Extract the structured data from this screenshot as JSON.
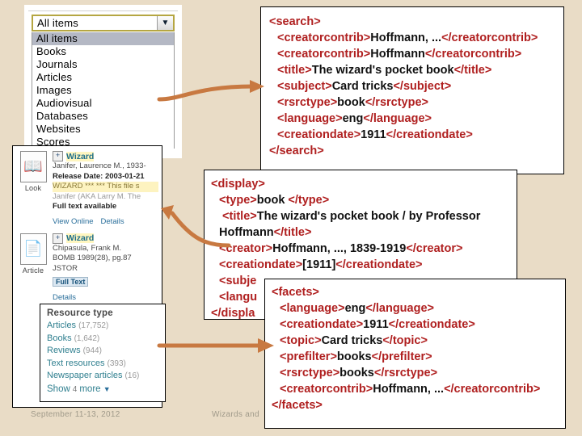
{
  "background_color": "#e9dcc6",
  "accent_arrow_color": "#c87941",
  "xml_tag_color": "#b02020",
  "dropdown": {
    "selected_value": "All items",
    "arrow_icon": "chevron-down-icon",
    "options": [
      "All items",
      "Books",
      "Journals",
      "Articles",
      "Images",
      "Audiovisual",
      "Databases",
      "Websites",
      "Scores"
    ]
  },
  "results": {
    "items": [
      {
        "icon_label": "Look",
        "icon_glyph": "book-icon",
        "expand": "+",
        "title": "Wizard",
        "lines": [
          "Janifer, Laurence M., 1933-",
          "Release Date: 2003-01-21",
          "WIZARD *** *** This file s",
          "Janifer (AKA Larry M.  The",
          "Full text available"
        ],
        "links": [
          "View Online",
          "Details"
        ]
      },
      {
        "icon_label": "Article",
        "icon_glyph": "article-icon",
        "expand": "+",
        "title": "Wizard",
        "lines": [
          "Chipasula, Frank M.",
          "BOMB  1989(28), pg.87",
          "JSTOR"
        ],
        "badge": "Full Text",
        "links": [
          "Details"
        ]
      }
    ]
  },
  "facet_panel": {
    "header": "Resource type",
    "rows": [
      {
        "label": "Articles",
        "count": "(17,752)"
      },
      {
        "label": "Books",
        "count": "(1,642)"
      },
      {
        "label": "Reviews",
        "count": "(944)"
      },
      {
        "label": "Text resources",
        "count": "(393)"
      },
      {
        "label": "Newspaper articles",
        "count": "(16)"
      }
    ],
    "more_label": "Show",
    "more_count": "4",
    "more_suffix": "more",
    "more_caret": "chevron-down-icon"
  },
  "search_xml": {
    "open": "<search>",
    "close": "</search>",
    "lines": [
      {
        "tag": "creatorcontrib",
        "value": "Hoffmann, ..."
      },
      {
        "tag": "creatorcontrib",
        "value": "Hoffmann"
      },
      {
        "tag": "title",
        "value": "The wizard's pocket book"
      },
      {
        "tag": "subject",
        "value": "Card tricks"
      },
      {
        "tag": "rsrctype",
        "value": "book"
      },
      {
        "tag": "language",
        "value": "eng"
      },
      {
        "tag": "creationdate",
        "value": "1911"
      }
    ]
  },
  "display_xml": {
    "open": "<display>",
    "close": "</display>",
    "lines": [
      {
        "tag": "type",
        "value": "book "
      },
      {
        "tag": "title",
        "value": "The wizard's pocket book / by Professor Hoffmann"
      },
      {
        "tag": "creator",
        "value": "Hoffmann, ..., 1839-1919"
      },
      {
        "tag": "creationdate",
        "value": "[1911]"
      },
      {
        "tag": "subject",
        "value": ""
      },
      {
        "tag": "language",
        "value": ""
      }
    ]
  },
  "facets_xml": {
    "open": "<facets>",
    "close": "</facets>",
    "lines": [
      {
        "tag": "language",
        "value": "eng"
      },
      {
        "tag": "creationdate",
        "value": "1911"
      },
      {
        "tag": "topic",
        "value": "Card tricks"
      },
      {
        "tag": "prefilter",
        "value": "books"
      },
      {
        "tag": "rsrctype",
        "value": "books"
      },
      {
        "tag": "creatorcontrib",
        "value": "Hoffmann, ..."
      }
    ]
  },
  "footer": {
    "left": "September 11-13, 2012",
    "center": "Wizards and"
  }
}
